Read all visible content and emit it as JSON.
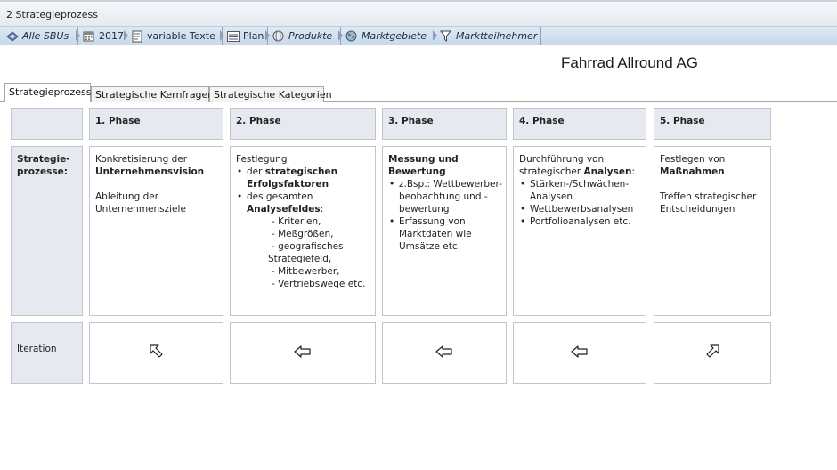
{
  "window": {
    "title": "2 Strategieprozess"
  },
  "toolbar": {
    "items": [
      {
        "label": "Alle SBUs",
        "icon": "globe-icon",
        "italic": true
      },
      {
        "label": "2017",
        "icon": "calendar-icon",
        "italic": false
      },
      {
        "label": "variable Texte",
        "icon": "document-icon",
        "italic": false
      },
      {
        "label": "Plan",
        "icon": "list-icon",
        "italic": false
      },
      {
        "label": "Produkte",
        "icon": "sphere-icon",
        "italic": true
      },
      {
        "label": "Marktgebiete",
        "icon": "world-icon",
        "italic": true
      },
      {
        "label": "Marktteilnehmer",
        "icon": "funnel-icon",
        "italic": true
      }
    ]
  },
  "header": {
    "company": "Fahrrad Allround AG"
  },
  "tabs": [
    {
      "label": "Strategieprozess",
      "active": true
    },
    {
      "label": "Strategische Kernfragen",
      "active": false
    },
    {
      "label": "Strategische Kategorien",
      "active": false
    }
  ],
  "grid": {
    "phases": [
      "1. Phase",
      "2. Phase",
      "3. Phase",
      "4. Phase",
      "5. Phase"
    ],
    "row_labels": {
      "process_line1": "Strategie-",
      "process_line2": "prozesse:",
      "iteration": "Iteration"
    },
    "phase1": {
      "line1": "Konkretisierung der",
      "line2": "Unternehmensvision",
      "line3": "Ableitung der",
      "line4": "Unternehmensziele"
    },
    "phase2": {
      "intro": "Festlegung",
      "b1_prefix": "der ",
      "b1_bold": "strategischen",
      "b1_bold2": "Erfolgsfaktoren",
      "b2_prefix": "des gesamten",
      "b2_bold": "Analysefeldes",
      "b2_suffix": ":",
      "sub": [
        "- Kriterien,",
        "- Meßgrößen,",
        "- geografisches"
      ],
      "sub_cont": "Strategiefeld,",
      "sub2": [
        "- Mitbewerber,",
        "- Vertriebswege etc."
      ]
    },
    "phase3": {
      "bold1": "Messung und",
      "bold2": "Bewertung",
      "b1": [
        "z.Bsp.: Wettbewerber-",
        "beobachtung und -",
        "bewertung"
      ],
      "b2": [
        "Erfassung von",
        "Marktdaten wie",
        "Umsätze etc."
      ]
    },
    "phase4": {
      "line1": "Durchführung von",
      "line2_prefix": "strategischer ",
      "line2_bold": "Analysen",
      "line2_suffix": ":",
      "bullets": [
        "Stärken-/Schwächen-",
        "Analysen",
        "Wettbewerbsanalysen",
        "Portfolioanalysen etc."
      ]
    },
    "phase5": {
      "line1": "Festlegen von",
      "line2": "Maßnahmen",
      "line3": "Treffen strategischer",
      "line4": "Entscheidungen"
    },
    "iteration_arrows": [
      "arrow-up-left-icon",
      "arrow-left-icon",
      "arrow-left-icon",
      "arrow-left-icon",
      "arrow-up-right-icon"
    ]
  }
}
